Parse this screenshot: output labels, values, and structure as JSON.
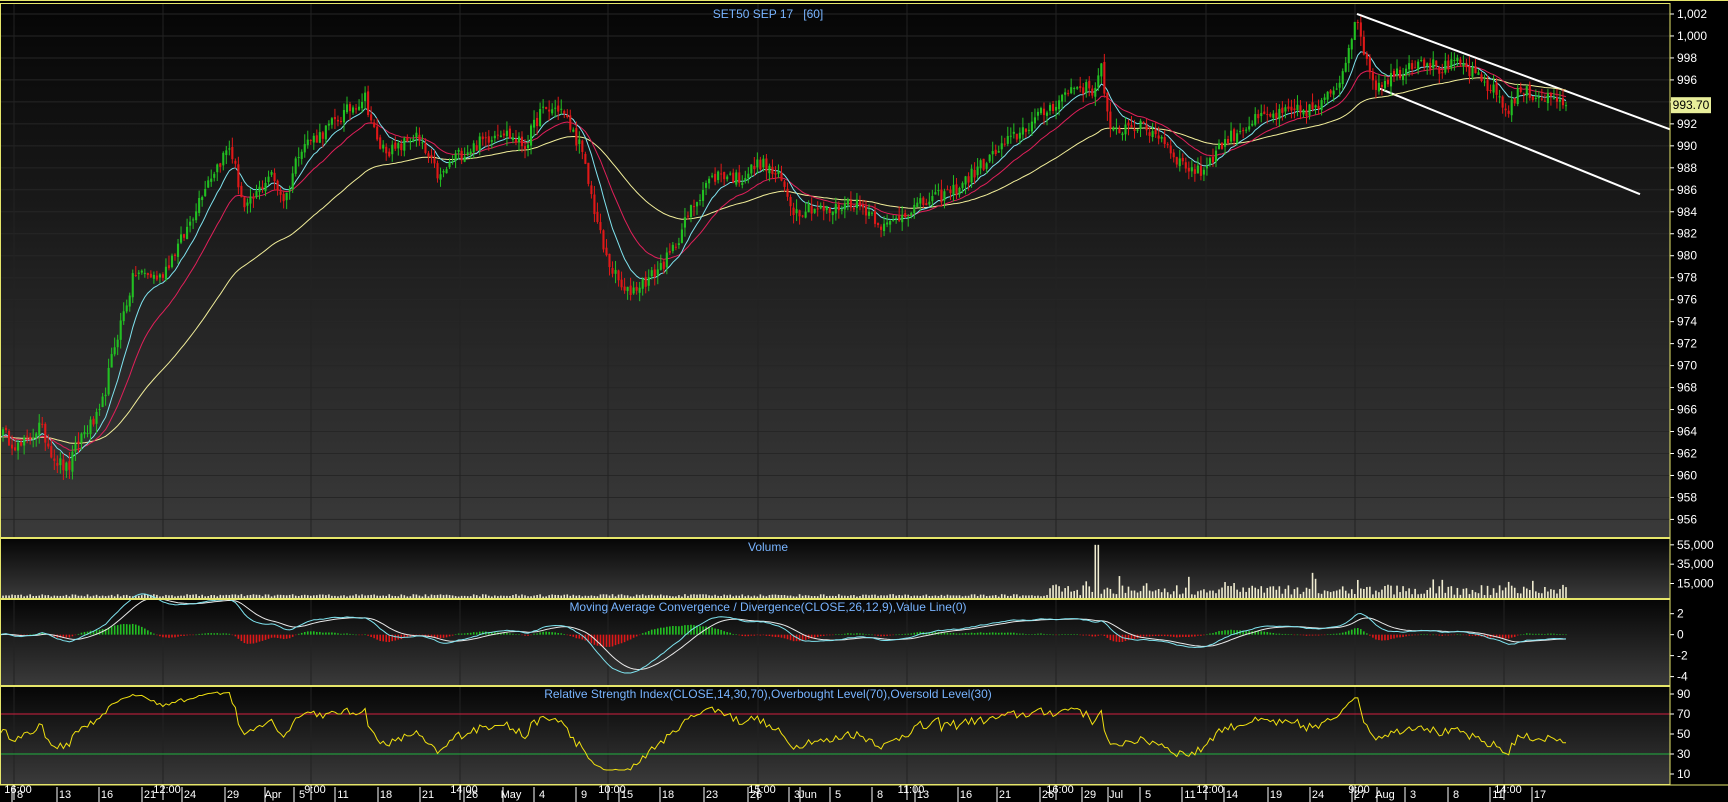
{
  "chart_data": {
    "type": "candlestick",
    "colors": {
      "background": "#000000",
      "frame": "#e6e66a",
      "axis_text": "#ffffff",
      "title_text": "#78b4ff",
      "up": "#22c022",
      "down": "#e01818",
      "ma_fast": "#7fe3ef",
      "ma_mid": "#e0205a",
      "ma_slow": "#f2ee9a",
      "volume": "#f0ecd0",
      "rsi": "#f0e010",
      "overbought": "#d02040",
      "oversold": "#20b040",
      "trendline": "#ffffff",
      "last_price_bg": "#e8ee9a"
    },
    "price_panel": {
      "title": "SET50 SEP 17   [60]",
      "ylim": [
        954.4,
        1003
      ],
      "yticks": [
        956,
        958,
        960,
        962,
        964,
        966,
        968,
        970,
        972,
        974,
        976,
        978,
        980,
        982,
        984,
        986,
        988,
        990,
        992,
        994,
        996,
        998,
        1000,
        1002
      ],
      "ytick_labels": [
        "956",
        "958",
        "960",
        "962",
        "964",
        "966",
        "968",
        "970",
        "972",
        "974",
        "976",
        "978",
        "980",
        "982",
        "984",
        "986",
        "988",
        "990",
        "992",
        "994",
        "996",
        "998",
        "1,000",
        "1,002"
      ],
      "last_price": "993.70",
      "price_path": [
        [
          0,
          964
        ],
        [
          20,
          962.5
        ],
        [
          40,
          964.5
        ],
        [
          55,
          961.5
        ],
        [
          68,
          960.5
        ],
        [
          80,
          963.5
        ],
        [
          100,
          965.5
        ],
        [
          115,
          972
        ],
        [
          135,
          978.5
        ],
        [
          160,
          978
        ],
        [
          185,
          982
        ],
        [
          205,
          986.5
        ],
        [
          230,
          990
        ],
        [
          245,
          984
        ],
        [
          270,
          987.5
        ],
        [
          285,
          985
        ],
        [
          300,
          990
        ],
        [
          320,
          991
        ],
        [
          345,
          993
        ],
        [
          365,
          994.5
        ],
        [
          378,
          990
        ],
        [
          395,
          989.5
        ],
        [
          415,
          991
        ],
        [
          440,
          987
        ],
        [
          455,
          989
        ],
        [
          475,
          990
        ],
        [
          500,
          991.5
        ],
        [
          525,
          990
        ],
        [
          540,
          993
        ],
        [
          560,
          993.5
        ],
        [
          580,
          990
        ],
        [
          605,
          980
        ],
        [
          625,
          976.5
        ],
        [
          650,
          978
        ],
        [
          670,
          980
        ],
        [
          690,
          984
        ],
        [
          705,
          986.5
        ],
        [
          720,
          987.5
        ],
        [
          740,
          987
        ],
        [
          760,
          988.5
        ],
        [
          780,
          987
        ],
        [
          795,
          984
        ],
        [
          810,
          984.5
        ],
        [
          830,
          984
        ],
        [
          850,
          985
        ],
        [
          870,
          984
        ],
        [
          885,
          982.5
        ],
        [
          905,
          984
        ],
        [
          930,
          985
        ],
        [
          955,
          986
        ],
        [
          985,
          988.5
        ],
        [
          1010,
          990.5
        ],
        [
          1030,
          992
        ],
        [
          1050,
          993.5
        ],
        [
          1075,
          995.5
        ],
        [
          1095,
          995
        ],
        [
          1100,
          998
        ],
        [
          1110,
          991
        ],
        [
          1130,
          992
        ],
        [
          1160,
          991
        ],
        [
          1180,
          988.5
        ],
        [
          1200,
          987.5
        ],
        [
          1220,
          990
        ],
        [
          1240,
          991.5
        ],
        [
          1260,
          992.5
        ],
        [
          1290,
          993
        ],
        [
          1320,
          993.5
        ],
        [
          1340,
          996
        ],
        [
          1355,
          1001.5
        ],
        [
          1375,
          995.5
        ],
        [
          1395,
          996.5
        ],
        [
          1420,
          998
        ],
        [
          1440,
          997
        ],
        [
          1460,
          997.5
        ],
        [
          1480,
          996
        ],
        [
          1500,
          994.5
        ],
        [
          1505,
          993
        ],
        [
          1520,
          995
        ],
        [
          1540,
          994.5
        ],
        [
          1560,
          994.2
        ],
        [
          1566,
          993.7
        ]
      ],
      "trendlines": [
        {
          "points": [
            [
              1357,
              1002
            ],
            [
              1670,
              991.5
            ]
          ]
        },
        {
          "points": [
            [
              1380,
              995.2
            ],
            [
              1640,
              985.6
            ]
          ]
        }
      ]
    },
    "volume_panel": {
      "title": "Volume",
      "ylim": [
        0,
        60000
      ],
      "yticks": [
        15000,
        35000,
        55000
      ],
      "ytick_labels": [
        "15,000",
        "35,000",
        "55,000"
      ]
    },
    "macd_panel": {
      "title": "Moving Average Convergence / Divergence(CLOSE,26,12,9),Value Line(0)",
      "ylim": [
        -4.8,
        3.4
      ],
      "yticks": [
        2,
        0,
        -2,
        -4
      ],
      "ytick_labels": [
        "2",
        "0",
        "-2",
        "-4"
      ]
    },
    "rsi_panel": {
      "title": "Relative Strength Index(CLOSE,14,30,70),Overbought Level(70),Oversold Level(30)",
      "ylim": [
        0,
        98
      ],
      "yticks": [
        10,
        30,
        50,
        70,
        90
      ],
      "ytick_labels": [
        "10",
        "30",
        "50",
        "70",
        "90"
      ],
      "overbought": 70,
      "oversold": 30
    },
    "x_axis": {
      "top_labels": [
        {
          "x": 18,
          "label": "16:00"
        },
        {
          "x": 167,
          "label": "12:00"
        },
        {
          "x": 315,
          "label": "9:00"
        },
        {
          "x": 464,
          "label": "14:00"
        },
        {
          "x": 612,
          "label": "10:00"
        },
        {
          "x": 762,
          "label": "15:00"
        },
        {
          "x": 911,
          "label": "11:00"
        },
        {
          "x": 1060,
          "label": "16:00"
        },
        {
          "x": 1210,
          "label": "12:00"
        },
        {
          "x": 1359,
          "label": "9:00"
        },
        {
          "x": 1508,
          "label": "14:00"
        }
      ],
      "bottom_labels": [
        {
          "x": 20,
          "label": "8"
        },
        {
          "x": 65,
          "label": "13"
        },
        {
          "x": 107,
          "label": "16"
        },
        {
          "x": 150,
          "label": "21"
        },
        {
          "x": 190,
          "label": "24"
        },
        {
          "x": 233,
          "label": "29"
        },
        {
          "x": 273,
          "label": "Apr"
        },
        {
          "x": 302,
          "label": "5"
        },
        {
          "x": 343,
          "label": "11"
        },
        {
          "x": 386,
          "label": "18"
        },
        {
          "x": 428,
          "label": "21"
        },
        {
          "x": 472,
          "label": "26"
        },
        {
          "x": 511,
          "label": "May"
        },
        {
          "x": 542,
          "label": "4"
        },
        {
          "x": 584,
          "label": "9"
        },
        {
          "x": 627,
          "label": "15"
        },
        {
          "x": 668,
          "label": "18"
        },
        {
          "x": 712,
          "label": "23"
        },
        {
          "x": 756,
          "label": "26"
        },
        {
          "x": 797,
          "label": "3"
        },
        {
          "x": 808,
          "label": "Jun"
        },
        {
          "x": 838,
          "label": "5"
        },
        {
          "x": 880,
          "label": "8"
        },
        {
          "x": 923,
          "label": "13"
        },
        {
          "x": 966,
          "label": "16"
        },
        {
          "x": 1005,
          "label": "21"
        },
        {
          "x": 1048,
          "label": "26"
        },
        {
          "x": 1090,
          "label": "29"
        },
        {
          "x": 1116,
          "label": "Jul"
        },
        {
          "x": 1148,
          "label": "5"
        },
        {
          "x": 1190,
          "label": "11"
        },
        {
          "x": 1232,
          "label": "14"
        },
        {
          "x": 1276,
          "label": "19"
        },
        {
          "x": 1318,
          "label": "24"
        },
        {
          "x": 1360,
          "label": "27"
        },
        {
          "x": 1385,
          "label": "Aug"
        },
        {
          "x": 1413,
          "label": "3"
        },
        {
          "x": 1456,
          "label": "8"
        },
        {
          "x": 1498,
          "label": "11"
        },
        {
          "x": 1540,
          "label": "17"
        }
      ]
    }
  }
}
